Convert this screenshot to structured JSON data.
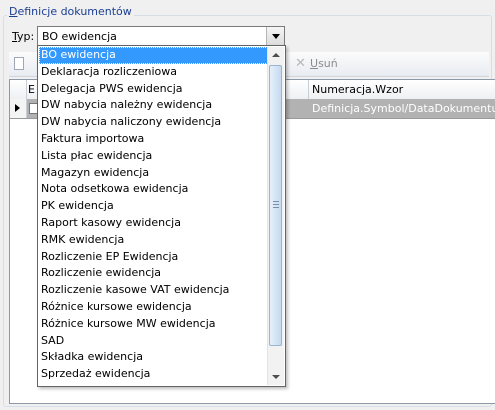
{
  "groupbox": {
    "title_first": "D",
    "title_rest": "efinicje dokumentów"
  },
  "type_field": {
    "label_first": "T",
    "label_rest": "yp:",
    "value": "BO ewidencja"
  },
  "toolbar": {
    "delete_first": "U",
    "delete_rest": "suń"
  },
  "grid": {
    "col1_header": "E",
    "col2_header": "Numeracja.Wzor",
    "rows": [
      {
        "numeracja": "Definicja.Symbol/DataDokumentu"
      }
    ]
  },
  "dropdown": {
    "selected_index": 0,
    "options": [
      "BO ewidencja",
      "Deklaracja rozliczeniowa",
      "Delegacja PWS ewidencja",
      "DW nabycia należny ewidencja",
      "DW nabycia naliczony ewidencja",
      "Faktura importowa",
      "Lista płac ewidencja",
      "Magazyn ewidencja",
      "Nota odsetkowa ewidencja",
      "PK ewidencja",
      "Raport kasowy ewidencja",
      "RMK ewidencja",
      "Rozliczenie EP Ewidencja",
      "Rozliczenie ewidencja",
      "Rozliczenie kasowe VAT ewidencja",
      "Różnice kursowe ewidencja",
      "Różnice kursowe MW ewidencja",
      "SAD",
      "Składka ewidencja",
      "Sprzedaż ewidencja"
    ]
  },
  "colors": {
    "selection": "#3399ff",
    "group_title": "#1c3f93",
    "row_selected": "#b2b2b2"
  }
}
